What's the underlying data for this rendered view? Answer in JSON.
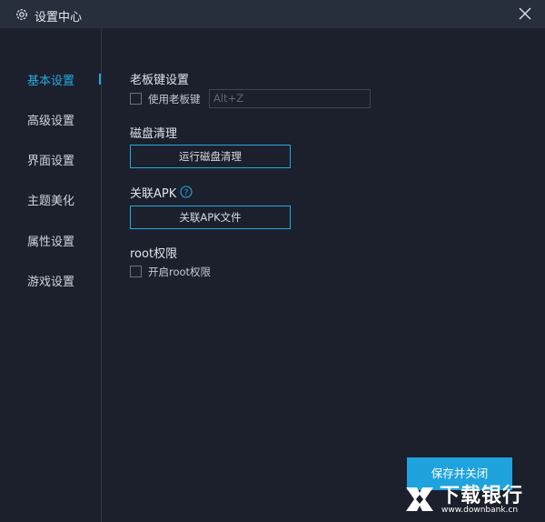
{
  "window": {
    "title": "设置中心"
  },
  "sidebar": {
    "items": [
      {
        "label": "基本设置"
      },
      {
        "label": "高级设置"
      },
      {
        "label": "界面设置"
      },
      {
        "label": "主题美化"
      },
      {
        "label": "属性设置"
      },
      {
        "label": "游戏设置"
      }
    ],
    "active_index": 0
  },
  "boss_key": {
    "title": "老板键设置",
    "checkbox_label": "使用老板键",
    "checked": false,
    "hotkey_value": "Alt+Z"
  },
  "disk_clean": {
    "title": "磁盘清理",
    "button_label": "运行磁盘清理"
  },
  "apk": {
    "title": "关联APK",
    "help_icon": "question-circle-icon",
    "button_label": "关联APK文件"
  },
  "root": {
    "title": "root权限",
    "checkbox_label": "开启root权限",
    "checked": false
  },
  "footer": {
    "save_label": "保存并关闭"
  },
  "watermark": {
    "text": "下载银行",
    "url": "www.downbank.cn"
  },
  "colors": {
    "accent": "#27a9e0",
    "background": "#1b202c",
    "titlebar": "#272e3c",
    "primary_button": "#1fa3dd"
  }
}
